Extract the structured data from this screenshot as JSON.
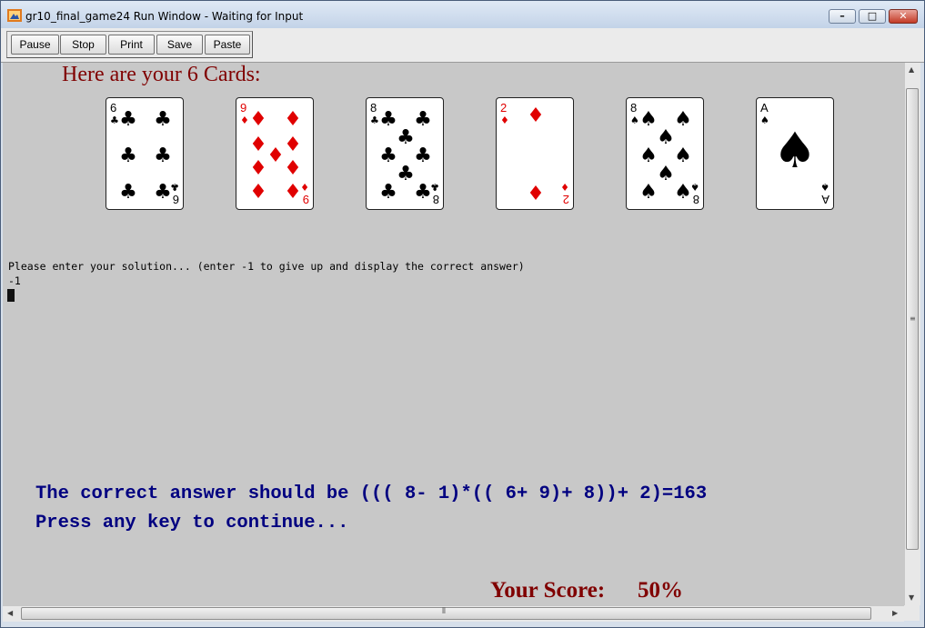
{
  "window": {
    "title": "gr10_final_game24 Run Window - Waiting for Input"
  },
  "toolbar": {
    "buttons": [
      {
        "label": "Pause"
      },
      {
        "label": "Stop"
      },
      {
        "label": "Print"
      },
      {
        "label": "Save"
      },
      {
        "label": "Paste"
      }
    ]
  },
  "main": {
    "heading": "Here are your 6 Cards:",
    "cards": [
      {
        "rank": "6",
        "suit": "clubs",
        "color": "#000000"
      },
      {
        "rank": "9",
        "suit": "diamonds",
        "color": "#e00000"
      },
      {
        "rank": "8",
        "suit": "clubs",
        "color": "#000000"
      },
      {
        "rank": "2",
        "suit": "diamonds",
        "color": "#e00000"
      },
      {
        "rank": "8",
        "suit": "spades",
        "color": "#000000"
      },
      {
        "rank": "A",
        "suit": "spades",
        "color": "#000000"
      }
    ],
    "prompt": "Please enter your solution... (enter -1 to give up and display the correct answer)",
    "input_echo": "-1",
    "answer_line": "The correct answer should be ((( 8- 1)*(( 6+ 9)+ 8))+ 2)=163",
    "continue_line": "Press any key to continue...",
    "score_label": "Your Score:",
    "score_value": "50%"
  },
  "colors": {
    "heading": "#800000",
    "answer_text": "#000080",
    "content_bg": "#c8c8c8"
  }
}
